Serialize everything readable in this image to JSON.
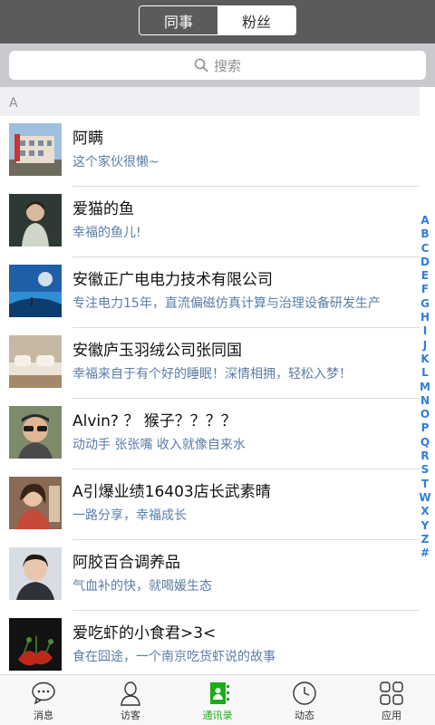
{
  "header": {
    "segments": [
      {
        "label": "同事",
        "active": true
      },
      {
        "label": "粉丝",
        "active": false
      }
    ]
  },
  "search": {
    "placeholder": "搜索",
    "icon": "search-icon"
  },
  "section_letter": "A",
  "contacts": [
    {
      "name": "阿瞒",
      "desc": "这个家伙很懒~"
    },
    {
      "name": "爱猫的鱼",
      "desc": "幸福的鱼儿!"
    },
    {
      "name": "安徽正广电电力技术有限公司",
      "desc": "专注电力15年，直流偏磁仿真计算与治理设备研发生产"
    },
    {
      "name": "安徽庐玉羽绒公司张同国",
      "desc": "幸福来自于有个好的睡眠！深情相拥，轻松入梦！"
    },
    {
      "name": "Alvin? ？ 猴子？？？？",
      "desc": "动动手 张张嘴 收入就像自来水"
    },
    {
      "name": "A引爆业绩16403店长武素晴",
      "desc": "一路分享，幸福成长"
    },
    {
      "name": "阿胶百合调养品",
      "desc": "气血补的快，就喝媛生态"
    },
    {
      "name": "爱吃虾的小食君>3<",
      "desc": "食在囧途，一个南京吃货虾说的故事"
    }
  ],
  "index_letters": [
    "A",
    "B",
    "C",
    "D",
    "E",
    "F",
    "G",
    "H",
    "I",
    "J",
    "K",
    "L",
    "M",
    "N",
    "O",
    "P",
    "Q",
    "R",
    "S",
    "T",
    "W",
    "X",
    "Y",
    "Z",
    "#"
  ],
  "tabs": [
    {
      "label": "消息",
      "icon": "message-icon",
      "active": false
    },
    {
      "label": "访客",
      "icon": "person-icon",
      "active": false
    },
    {
      "label": "通讯录",
      "icon": "contacts-icon",
      "active": true
    },
    {
      "label": "动态",
      "icon": "clock-icon",
      "active": false
    },
    {
      "label": "应用",
      "icon": "apps-icon",
      "active": false
    }
  ],
  "colors": {
    "accent": "#1aad19",
    "index": "#2f7de1",
    "desc_text": "#5a7ea8",
    "topbar": "#5b5b5b"
  }
}
